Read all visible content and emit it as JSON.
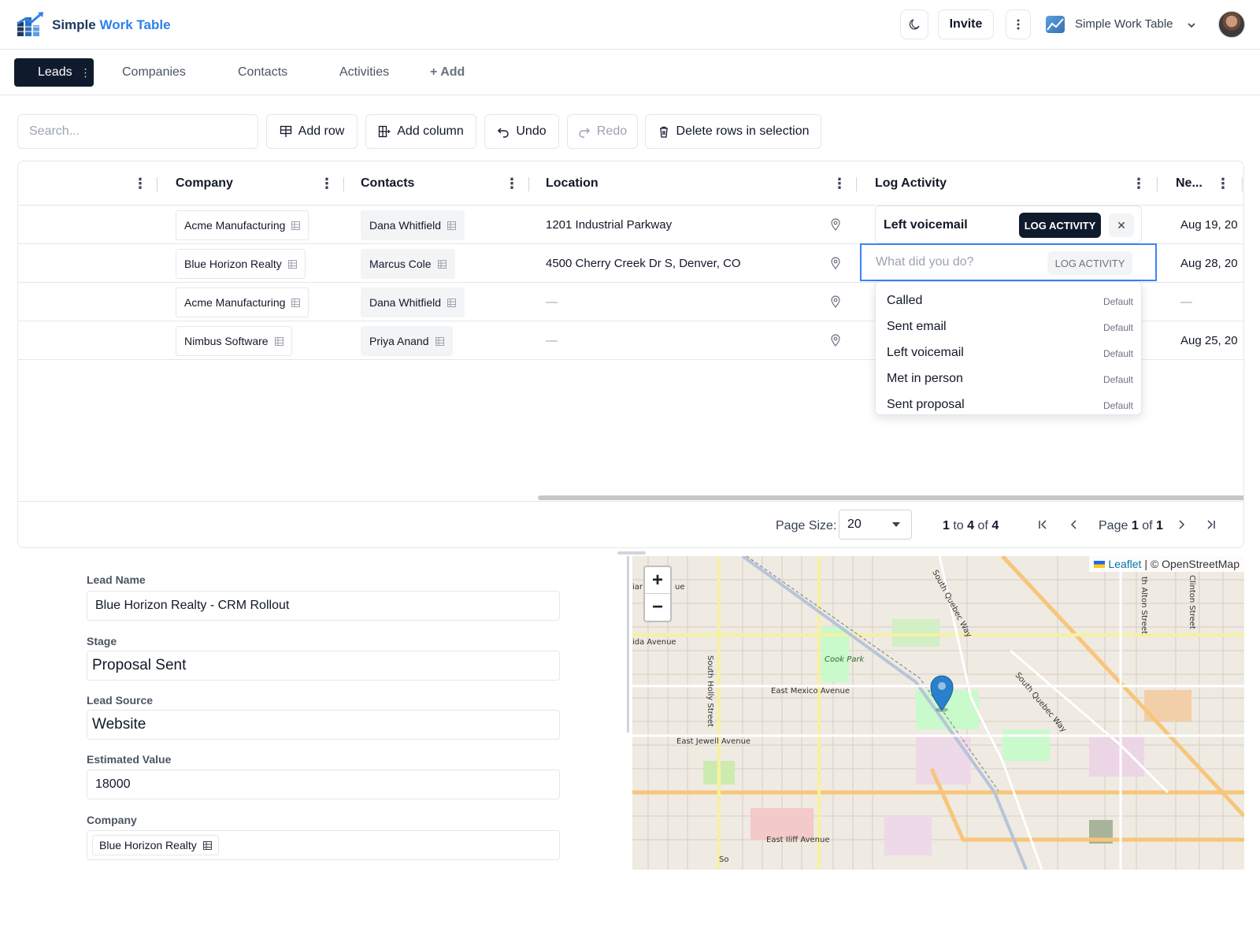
{
  "app": {
    "brand_part1": "Simple ",
    "brand_part2": "Work Table"
  },
  "header": {
    "invite_label": "Invite",
    "workspace_name": "Simple Work Table"
  },
  "tabs": [
    {
      "label": "Leads",
      "active": true
    },
    {
      "label": "Companies"
    },
    {
      "label": "Contacts"
    },
    {
      "label": "Activities"
    },
    {
      "label": "+ Add"
    }
  ],
  "toolbar": {
    "search_placeholder": "Search...",
    "add_row": "Add row",
    "add_column": "Add column",
    "undo": "Undo",
    "redo": "Redo",
    "delete_rows": "Delete rows in selection"
  },
  "grid": {
    "columns": [
      "Company",
      "Contacts",
      "Location",
      "Log Activity",
      "Ne..."
    ],
    "rows": [
      {
        "company": "Acme Manufacturing",
        "contact": "Dana Whitfield",
        "location": "1201 Industrial Parkway",
        "next": "Aug 19, 20"
      },
      {
        "company": "Blue Horizon Realty",
        "contact": "Marcus Cole",
        "location": "4500 Cherry Creek Dr S, Denver, CO",
        "next": "Aug 28, 20"
      },
      {
        "company": "Acme Manufacturing",
        "contact": "Dana Whitfield",
        "location": "—",
        "next": "—"
      },
      {
        "company": "Nimbus Software",
        "contact": "Priya Anand",
        "location": "—",
        "next": "Aug 25, 20"
      }
    ],
    "log_activity": {
      "current_value": "Left voicemail",
      "button_label": "LOG ACTIVITY",
      "close_symbol": "✕",
      "input_placeholder": "What did you do?",
      "options": [
        {
          "label": "Called",
          "tag": "Default"
        },
        {
          "label": "Sent email",
          "tag": "Default"
        },
        {
          "label": "Left voicemail",
          "tag": "Default"
        },
        {
          "label": "Met in person",
          "tag": "Default"
        },
        {
          "label": "Sent proposal",
          "tag": "Default"
        }
      ]
    },
    "pagination": {
      "page_size_label": "Page Size:",
      "page_size": "20",
      "range_from": "1",
      "range_to_word": "to",
      "range_to": "4",
      "range_of_word": "of",
      "range_total": "4",
      "page_word": "Page",
      "page_current": "1",
      "page_of_word": "of",
      "page_total": "1"
    }
  },
  "form": {
    "lead_name_label": "Lead Name",
    "lead_name": "Blue Horizon Realty - CRM Rollout",
    "stage_label": "Stage",
    "stage": "Proposal Sent",
    "lead_source_label": "Lead Source",
    "lead_source": "Website",
    "estimated_value_label": "Estimated Value",
    "estimated_value": "18000",
    "company_label": "Company",
    "company": "Blue Horizon Realty"
  },
  "map": {
    "zoom_in": "+",
    "zoom_out": "−",
    "attribution_leaflet": "Leaflet",
    "attribution_rest": "| © OpenStreetMap",
    "streets": [
      "South Quebec Way",
      "Cook Park",
      "East Mexico Avenue",
      "South Holly Street",
      "East Jewell Avenue",
      "East Iliff Avenue",
      "South Quebec Way",
      "ida Avenue",
      "th Alton Street",
      "Clinton Street",
      "iar",
      "ue",
      "So"
    ]
  },
  "colors": {
    "accent": "#2f80ed",
    "dark": "#0f1b2d",
    "focus": "#3b82f6"
  }
}
